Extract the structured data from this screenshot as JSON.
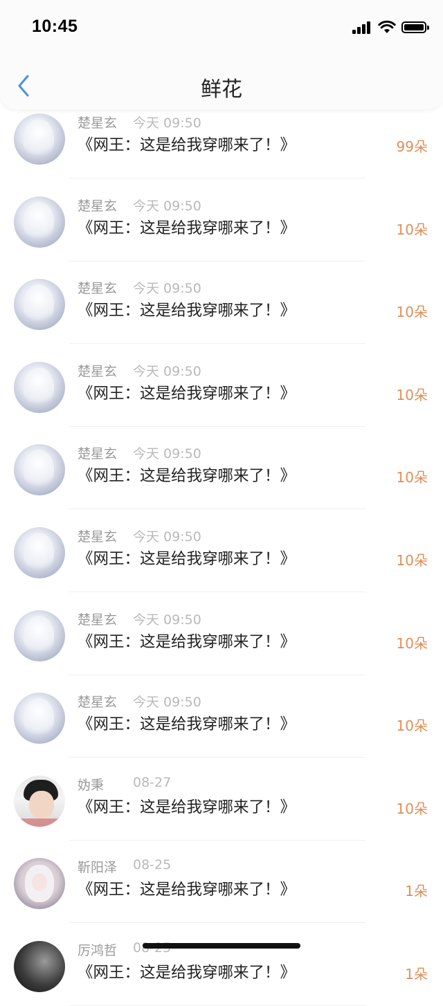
{
  "status_bar": {
    "time": "10:45"
  },
  "header": {
    "title": "鲜花"
  },
  "items": [
    {
      "name": "楚星玄",
      "time": "今天 09:50",
      "book": "《网王：这是给我穿哪来了！》",
      "count": "99朵",
      "avatar": "light"
    },
    {
      "name": "楚星玄",
      "time": "今天 09:50",
      "book": "《网王：这是给我穿哪来了！》",
      "count": "10朵",
      "avatar": "light"
    },
    {
      "name": "楚星玄",
      "time": "今天 09:50",
      "book": "《网王：这是给我穿哪来了！》",
      "count": "10朵",
      "avatar": "light"
    },
    {
      "name": "楚星玄",
      "time": "今天 09:50",
      "book": "《网王：这是给我穿哪来了！》",
      "count": "10朵",
      "avatar": "light"
    },
    {
      "name": "楚星玄",
      "time": "今天 09:50",
      "book": "《网王：这是给我穿哪来了！》",
      "count": "10朵",
      "avatar": "light"
    },
    {
      "name": "楚星玄",
      "time": "今天 09:50",
      "book": "《网王：这是给我穿哪来了！》",
      "count": "10朵",
      "avatar": "light"
    },
    {
      "name": "楚星玄",
      "time": "今天 09:50",
      "book": "《网王：这是给我穿哪来了！》",
      "count": "10朵",
      "avatar": "light"
    },
    {
      "name": "楚星玄",
      "time": "今天 09:50",
      "book": "《网王：这是给我穿哪来了！》",
      "count": "10朵",
      "avatar": "light"
    },
    {
      "name": "妫秉",
      "time": "08-27",
      "book": "《网王：这是给我穿哪来了！》",
      "count": "10朵",
      "avatar": "boy"
    },
    {
      "name": "靳阳泽",
      "time": "08-25",
      "book": "《网王：这是给我穿哪来了！》",
      "count": "1朵",
      "avatar": "girl"
    },
    {
      "name": "厉鸿哲",
      "time": "08-25",
      "book": "《网王：这是给我穿哪来了！》",
      "count": "1朵",
      "avatar": "dark"
    }
  ]
}
